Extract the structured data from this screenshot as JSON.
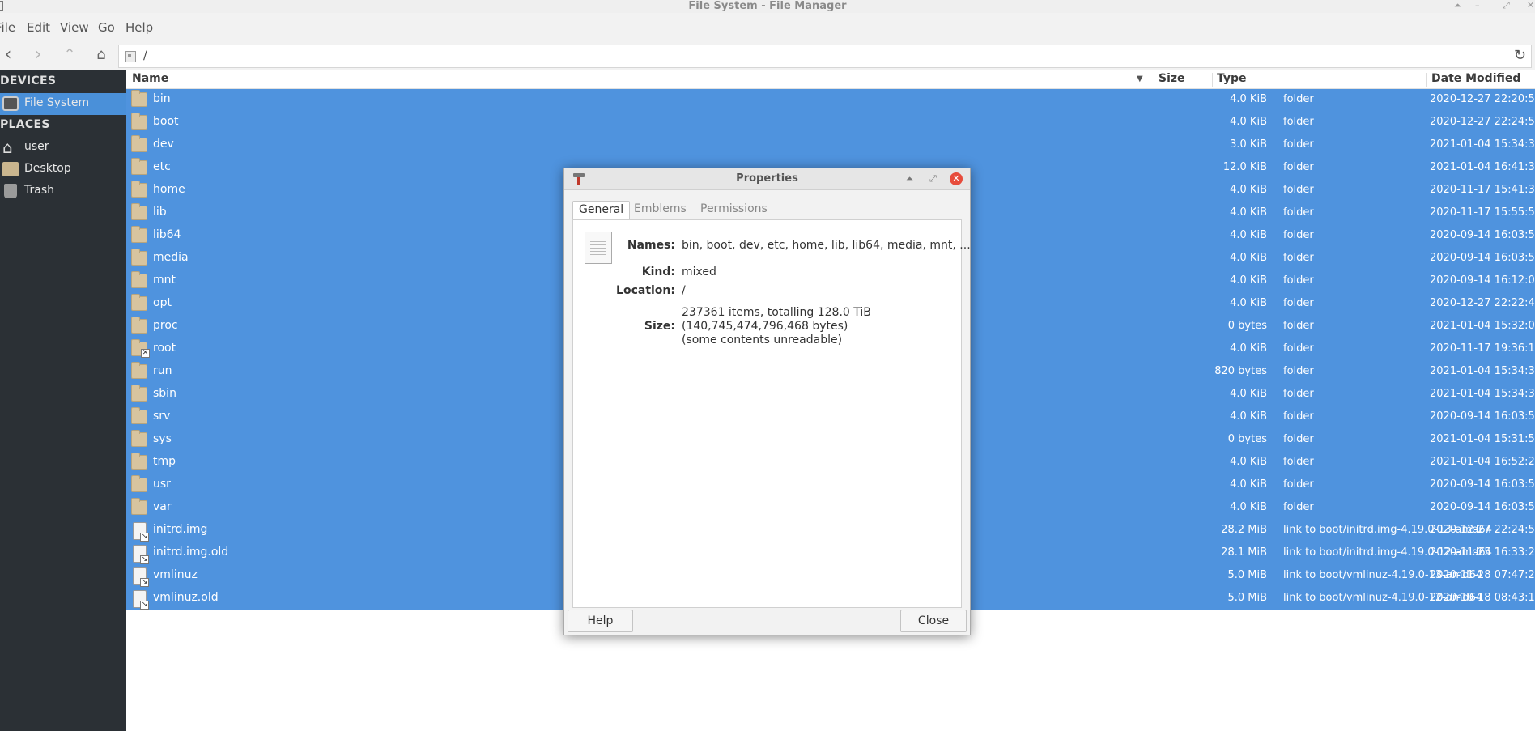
{
  "window": {
    "title": "File System - File Manager"
  },
  "menubar": [
    "File",
    "Edit",
    "View",
    "Go",
    "Help"
  ],
  "location": {
    "path": "/"
  },
  "sidebar": {
    "devices_heading": "DEVICES",
    "places_heading": "PLACES",
    "devices": [
      {
        "label": "File System",
        "icon": "drive-icon",
        "selected": true
      }
    ],
    "places": [
      {
        "label": "user",
        "icon": "home-icon"
      },
      {
        "label": "Desktop",
        "icon": "desktop-folder-icon"
      },
      {
        "label": "Trash",
        "icon": "trash-icon"
      }
    ]
  },
  "columns": {
    "name": "Name",
    "size": "Size",
    "type": "Type",
    "date": "Date Modified"
  },
  "files": [
    {
      "name": "bin",
      "size": "4.0 KiB",
      "type": "folder",
      "date": "2020-12-27 22:20:5",
      "icon": "folder"
    },
    {
      "name": "boot",
      "size": "4.0 KiB",
      "type": "folder",
      "date": "2020-12-27 22:24:5",
      "icon": "folder"
    },
    {
      "name": "dev",
      "size": "3.0 KiB",
      "type": "folder",
      "date": "2021-01-04 15:34:3",
      "icon": "folder"
    },
    {
      "name": "etc",
      "size": "12.0 KiB",
      "type": "folder",
      "date": "2021-01-04 16:41:3",
      "icon": "folder"
    },
    {
      "name": "home",
      "size": "4.0 KiB",
      "type": "folder",
      "date": "2020-11-17 15:41:3",
      "icon": "folder"
    },
    {
      "name": "lib",
      "size": "4.0 KiB",
      "type": "folder",
      "date": "2020-11-17 15:55:5",
      "icon": "folder"
    },
    {
      "name": "lib64",
      "size": "4.0 KiB",
      "type": "folder",
      "date": "2020-09-14 16:03:5",
      "icon": "folder"
    },
    {
      "name": "media",
      "size": "4.0 KiB",
      "type": "folder",
      "date": "2020-09-14 16:03:5",
      "icon": "folder"
    },
    {
      "name": "mnt",
      "size": "4.0 KiB",
      "type": "folder",
      "date": "2020-09-14 16:12:0",
      "icon": "folder"
    },
    {
      "name": "opt",
      "size": "4.0 KiB",
      "type": "folder",
      "date": "2020-12-27 22:22:4",
      "icon": "folder"
    },
    {
      "name": "proc",
      "size": "0 bytes",
      "type": "folder",
      "date": "2021-01-04 15:32:0",
      "icon": "folder"
    },
    {
      "name": "root",
      "size": "4.0 KiB",
      "type": "folder",
      "date": "2020-11-17 19:36:1",
      "icon": "folder-locked"
    },
    {
      "name": "run",
      "size": "820 bytes",
      "type": "folder",
      "date": "2021-01-04 15:34:3",
      "icon": "folder"
    },
    {
      "name": "sbin",
      "size": "4.0 KiB",
      "type": "folder",
      "date": "2021-01-04 15:34:3",
      "icon": "folder"
    },
    {
      "name": "srv",
      "size": "4.0 KiB",
      "type": "folder",
      "date": "2020-09-14 16:03:5",
      "icon": "folder"
    },
    {
      "name": "sys",
      "size": "0 bytes",
      "type": "folder",
      "date": "2021-01-04 15:31:5",
      "icon": "folder"
    },
    {
      "name": "tmp",
      "size": "4.0 KiB",
      "type": "folder",
      "date": "2021-01-04 16:52:2",
      "icon": "folder"
    },
    {
      "name": "usr",
      "size": "4.0 KiB",
      "type": "folder",
      "date": "2020-09-14 16:03:5",
      "icon": "folder"
    },
    {
      "name": "var",
      "size": "4.0 KiB",
      "type": "folder",
      "date": "2020-09-14 16:03:5",
      "icon": "folder"
    },
    {
      "name": "initrd.img",
      "size": "28.2 MiB",
      "type": "link to boot/initrd.img-4.19.0-13-amd64",
      "date": "2020-12-27 22:24:5",
      "icon": "link"
    },
    {
      "name": "initrd.img.old",
      "size": "28.1 MiB",
      "type": "link to boot/initrd.img-4.19.0-12-amd64",
      "date": "2020-11-25 16:33:2",
      "icon": "link"
    },
    {
      "name": "vmlinuz",
      "size": "5.0 MiB",
      "type": "link to boot/vmlinuz-4.19.0-13-amd64",
      "date": "2020-11-28 07:47:2",
      "icon": "link"
    },
    {
      "name": "vmlinuz.old",
      "size": "5.0 MiB",
      "type": "link to boot/vmlinuz-4.19.0-12-amd64",
      "date": "2020-10-18 08:43:1",
      "icon": "link"
    }
  ],
  "dialog": {
    "title": "Properties",
    "tabs": [
      "General",
      "Emblems",
      "Permissions"
    ],
    "active_tab": "General",
    "names_label": "Names:",
    "names_value": "bin, boot, dev, etc, home, lib, lib64, media, mnt, ...",
    "kind_label": "Kind:",
    "kind_value": "mixed",
    "location_label": "Location:",
    "location_value": "/",
    "size_label": "Size:",
    "size_line1": "237361 items, totalling 128.0 TiB",
    "size_line2": "(140,745,474,796,468 bytes)",
    "size_line3": "(some contents unreadable)",
    "help_button": "Help",
    "close_button": "Close"
  },
  "colors": {
    "selection": "#4f93de",
    "sidebar_bg": "#2b3035",
    "sidebar_selected": "#4a90d9",
    "close_button": "#e74c3c"
  }
}
